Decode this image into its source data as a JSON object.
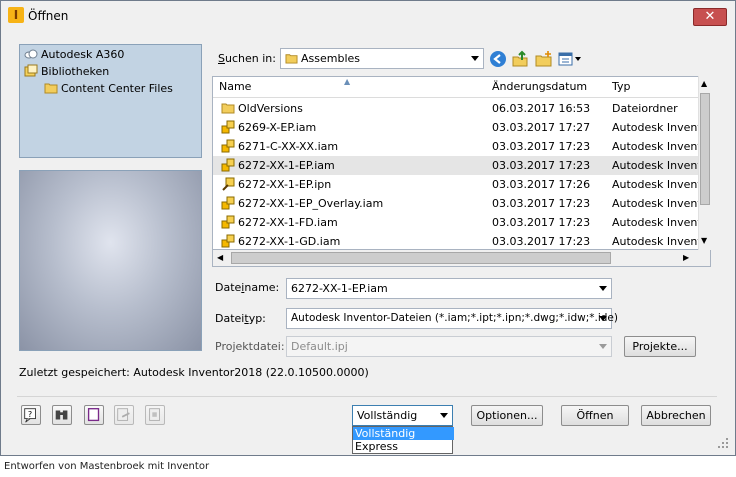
{
  "window": {
    "title": "Öffnen",
    "close_symbol": "✕",
    "app_icon": "I",
    "app_icon_name": "inventor-app-icon"
  },
  "places": [
    {
      "label": "Autodesk A360",
      "icon": "cloud-icon"
    },
    {
      "label": "Bibliotheken",
      "icon": "libraries-icon"
    },
    {
      "label": "Content Center Files",
      "icon": "folder-icon"
    }
  ],
  "look_in": {
    "label_underlined": "S",
    "label_rest": "uchen in:",
    "value": "Assembles"
  },
  "file_list": {
    "columns": [
      "Name",
      "Änderungsdatum",
      "Typ"
    ],
    "rows": [
      {
        "name": "OldVersions",
        "date": "06.03.2017 16:53",
        "type": "Dateiordner",
        "icon": "folder-icon",
        "selected": false
      },
      {
        "name": "6269-X-EP.iam",
        "date": "03.03.2017 17:27",
        "type": "Autodesk Inventor",
        "icon": "assembly-file-icon",
        "selected": false
      },
      {
        "name": "6271-C-XX-XX.iam",
        "date": "03.03.2017 17:23",
        "type": "Autodesk Inventor",
        "icon": "assembly-file-icon",
        "selected": false
      },
      {
        "name": "6272-XX-1-EP.iam",
        "date": "03.03.2017 17:23",
        "type": "Autodesk Inventor",
        "icon": "assembly-file-icon",
        "selected": true
      },
      {
        "name": "6272-XX-1-EP.ipn",
        "date": "03.03.2017 17:26",
        "type": "Autodesk Inventor",
        "icon": "presentation-file-icon",
        "selected": false
      },
      {
        "name": "6272-XX-1-EP_Overlay.iam",
        "date": "03.03.2017 17:23",
        "type": "Autodesk Inventor",
        "icon": "assembly-file-icon",
        "selected": false
      },
      {
        "name": "6272-XX-1-FD.iam",
        "date": "03.03.2017 17:23",
        "type": "Autodesk Inventor",
        "icon": "assembly-file-icon",
        "selected": false
      },
      {
        "name": "6272-XX-1-GD.iam",
        "date": "03.03.2017 17:23",
        "type": "Autodesk Inventor",
        "icon": "assembly-file-icon",
        "selected": false
      }
    ]
  },
  "filename": {
    "label_pre": "Date",
    "label_underlined": "i",
    "label_rest": "name:",
    "value": "6272-XX-1-EP.iam"
  },
  "filetype": {
    "label_pre": "Datei",
    "label_underlined": "t",
    "label_rest": "yp:",
    "value": "Autodesk Inventor-Dateien (*.iam;*.ipt;*.ipn;*.dwg;*.idw;*.ide)"
  },
  "project": {
    "label_pre": "Pro",
    "label_underlined": "j",
    "label_rest": "ektdatei:",
    "value": "Default.ipj",
    "button_label": "Projekte..."
  },
  "last_saved": "Zuletzt gespeichert: Autodesk Inventor2018 (22.0.10500.0000)",
  "options_combo": {
    "value": "Vollständig",
    "dropdown_options": [
      "Vollständig",
      "Express"
    ]
  },
  "buttons": {
    "options": "Optionen...",
    "open": "Öffnen",
    "cancel": "Abbrechen"
  },
  "footer": "Entworfen von Mastenbroek mit Inventor",
  "colors": {
    "selection_blue": "#3399ff",
    "close_red": "#c75050",
    "places_bg": "#c2d3e3"
  }
}
